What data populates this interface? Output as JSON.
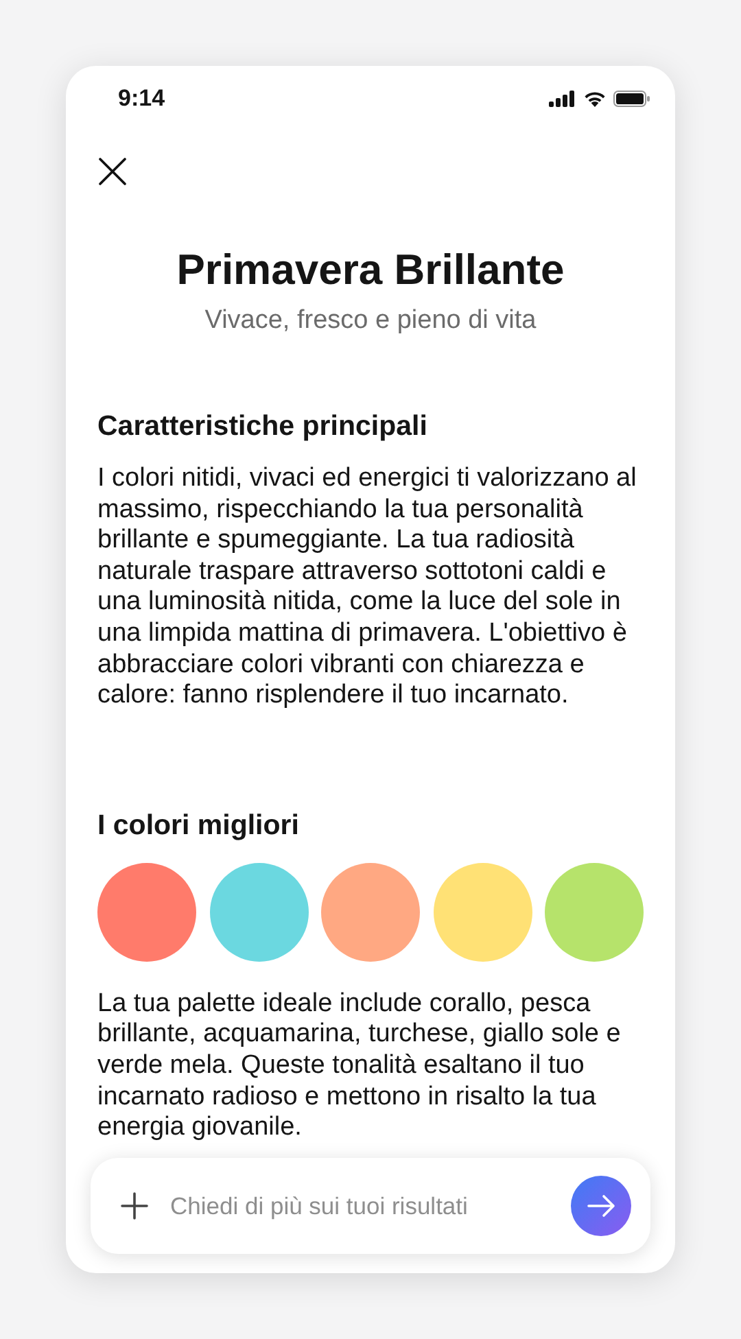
{
  "status_bar": {
    "time": "9:14"
  },
  "title": "Primavera Brillante",
  "subtitle": "Vivace, fresco e pieno di vita",
  "sections": [
    {
      "kind": "text",
      "heading": "Caratteristiche principali",
      "paragraphs": [
        "I colori nitidi, vivaci ed energici ti valorizzano al massimo, rispecchiando la tua personalità brillante e spumeggiante. La tua radiosità naturale traspare attraverso sottotoni caldi e una luminosità nitida, come la luce del sole in una limpida mattina di primavera. L'obiettivo è abbracciare colori vibranti con chiarezza e calore: fanno risplendere il tuo incarnato."
      ]
    },
    {
      "kind": "palette",
      "heading": "I colori migliori",
      "swatches": [
        {
          "color": "#ff7b6b"
        },
        {
          "color": "#6bd8e0"
        },
        {
          "color": "#ffa882"
        },
        {
          "color": "#ffe175"
        },
        {
          "color": "#b6e36b"
        }
      ],
      "paragraphs": [
        "La tua palette ideale include corallo, pesca brillante, acquamarina, turchese, giallo sole e verde mela. Queste tonalità esaltano il tuo incarnato radioso e mettono in risalto la tua energia giovanile."
      ]
    }
  ],
  "chat_input": {
    "placeholder": "Chiedi di più sui tuoi risultati"
  }
}
